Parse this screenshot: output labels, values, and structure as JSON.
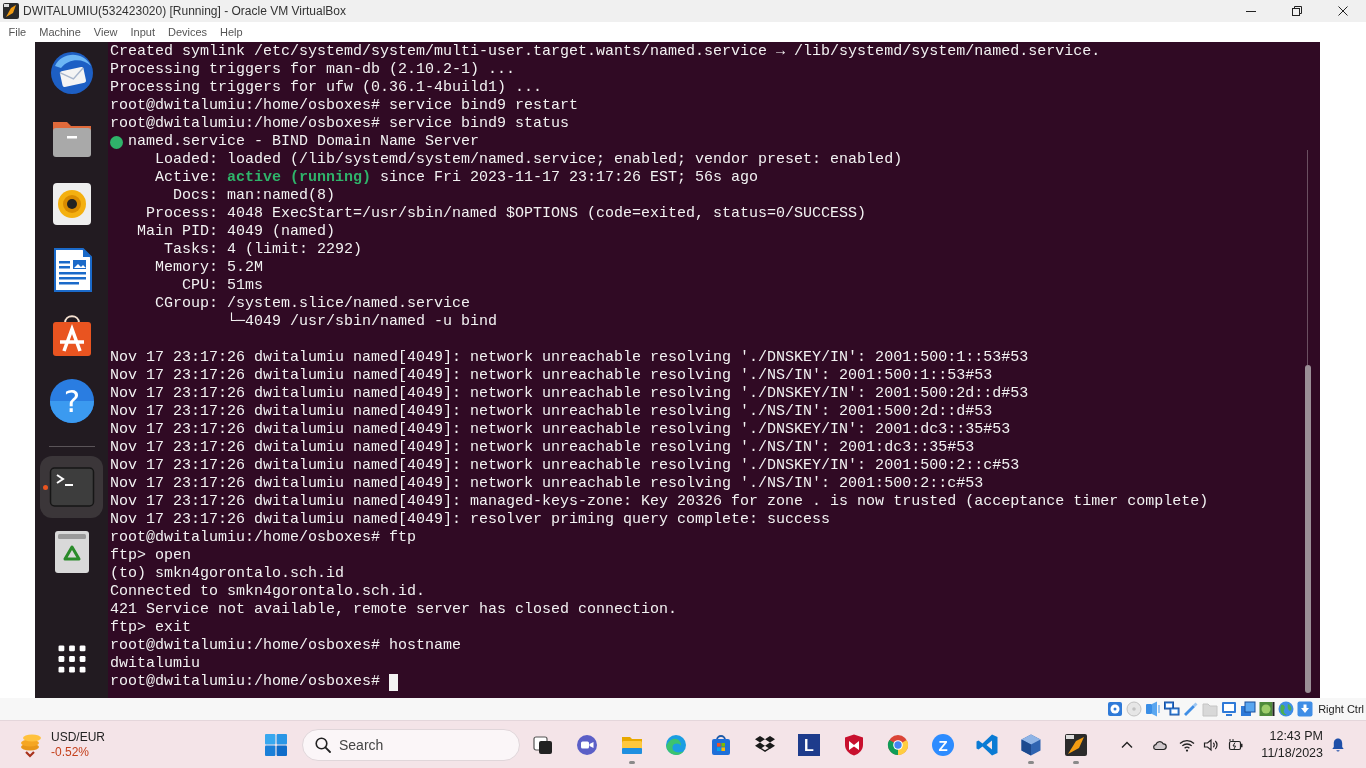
{
  "window": {
    "title": "DWITALUMIU(532423020) [Running] - Oracle VM VirtualBox"
  },
  "menu": [
    "File",
    "Machine",
    "View",
    "Input",
    "Devices",
    "Help"
  ],
  "dock": {
    "groups": [
      {
        "items": [
          {
            "kind": "mail",
            "selected": false,
            "running": false
          },
          {
            "kind": "files",
            "selected": false,
            "running": false
          },
          {
            "kind": "music",
            "selected": false,
            "running": false
          },
          {
            "kind": "writer",
            "selected": false,
            "running": false
          },
          {
            "kind": "store",
            "selected": false,
            "running": false
          },
          {
            "kind": "help",
            "glyph": "?",
            "selected": false,
            "running": false
          }
        ]
      },
      {
        "items": [
          {
            "kind": "terminal",
            "selected": true,
            "running": true
          },
          {
            "kind": "trash",
            "selected": false,
            "running": false
          }
        ]
      }
    ]
  },
  "terminal": {
    "cursor": true,
    "lines": [
      {
        "kind": "text",
        "text": "Created symlink /etc/systemd/system/multi-user.target.wants/named.service → /lib/systemd/system/named.service."
      },
      {
        "kind": "text",
        "text": "Processing triggers for man-db (2.10.2-1) ..."
      },
      {
        "kind": "text",
        "text": "Processing triggers for ufw (0.36.1-4build1) ..."
      },
      {
        "kind": "text",
        "text": "root@dwitalumiu:/home/osboxes# service bind9 restart"
      },
      {
        "kind": "text",
        "text": "root@dwitalumiu:/home/osboxes# service bind9 status"
      },
      {
        "kind": "unit",
        "text": "named.service - BIND Domain Name Server"
      },
      {
        "kind": "text",
        "text": "     Loaded: loaded (/lib/systemd/system/named.service; enabled; vendor preset: enabled)"
      },
      {
        "kind": "text",
        "text": "     Active: **active (running)** since Fri 2023-11-17 23:17:26 EST; 56s ago"
      },
      {
        "kind": "text",
        "text": "       Docs: man:named(8)"
      },
      {
        "kind": "text",
        "text": "    Process: 4048 ExecStart=/usr/sbin/named $OPTIONS (code=exited, status=0/SUCCESS)"
      },
      {
        "kind": "text",
        "text": "   Main PID: 4049 (named)"
      },
      {
        "kind": "text",
        "text": "      Tasks: 4 (limit: 2292)"
      },
      {
        "kind": "text",
        "text": "     Memory: 5.2M"
      },
      {
        "kind": "text",
        "text": "        CPU: 51ms"
      },
      {
        "kind": "text",
        "text": "     CGroup: /system.slice/named.service"
      },
      {
        "kind": "text",
        "text": "             └─4049 /usr/sbin/named -u bind"
      },
      {
        "kind": "blank"
      },
      {
        "kind": "text",
        "text": "Nov 17 23:17:26 dwitalumiu named[4049]: network unreachable resolving './DNSKEY/IN': 2001:500:1::53#53"
      },
      {
        "kind": "text",
        "text": "Nov 17 23:17:26 dwitalumiu named[4049]: network unreachable resolving './NS/IN': 2001:500:1::53#53"
      },
      {
        "kind": "text",
        "text": "Nov 17 23:17:26 dwitalumiu named[4049]: network unreachable resolving './DNSKEY/IN': 2001:500:2d::d#53"
      },
      {
        "kind": "text",
        "text": "Nov 17 23:17:26 dwitalumiu named[4049]: network unreachable resolving './NS/IN': 2001:500:2d::d#53"
      },
      {
        "kind": "text",
        "text": "Nov 17 23:17:26 dwitalumiu named[4049]: network unreachable resolving './DNSKEY/IN': 2001:dc3::35#53"
      },
      {
        "kind": "text",
        "text": "Nov 17 23:17:26 dwitalumiu named[4049]: network unreachable resolving './NS/IN': 2001:dc3::35#53"
      },
      {
        "kind": "text",
        "text": "Nov 17 23:17:26 dwitalumiu named[4049]: network unreachable resolving './DNSKEY/IN': 2001:500:2::c#53"
      },
      {
        "kind": "text",
        "text": "Nov 17 23:17:26 dwitalumiu named[4049]: network unreachable resolving './NS/IN': 2001:500:2::c#53"
      },
      {
        "kind": "text",
        "text": "Nov 17 23:17:26 dwitalumiu named[4049]: managed-keys-zone: Key 20326 for zone . is now trusted (acceptance timer complete)"
      },
      {
        "kind": "text",
        "text": "Nov 17 23:17:26 dwitalumiu named[4049]: resolver priming query complete: success"
      },
      {
        "kind": "text",
        "text": "root@dwitalumiu:/home/osboxes# ftp"
      },
      {
        "kind": "text",
        "text": "ftp> open"
      },
      {
        "kind": "text",
        "text": "(to) smkn4gorontalo.sch.id"
      },
      {
        "kind": "text",
        "text": "Connected to smkn4gorontalo.sch.id."
      },
      {
        "kind": "text",
        "text": "421 Service not available, remote server has closed connection."
      },
      {
        "kind": "text",
        "text": "ftp> exit"
      },
      {
        "kind": "text",
        "text": "root@dwitalumiu:/home/osboxes# hostname"
      },
      {
        "kind": "text",
        "text": "dwitalumiu"
      },
      {
        "kind": "prompt",
        "text": "root@dwitalumiu:/home/osboxes#"
      }
    ]
  },
  "status_bar": {
    "host_key": "Right Ctrl"
  },
  "taskbar": {
    "widget": {
      "title": "USD/EUR",
      "change": "-0.52%"
    },
    "search": {
      "placeholder": "Search"
    },
    "apps": [
      {
        "kind": "task-view",
        "running": false
      },
      {
        "kind": "meet",
        "running": false
      },
      {
        "kind": "explorer",
        "running": true
      },
      {
        "kind": "edge",
        "running": false
      },
      {
        "kind": "store",
        "running": false
      },
      {
        "kind": "dropbox",
        "running": false
      },
      {
        "kind": "letter-tile",
        "glyph": "L",
        "running": false
      },
      {
        "kind": "shield",
        "running": false
      },
      {
        "kind": "chrome",
        "running": false
      },
      {
        "kind": "letter-circle",
        "glyph": "Z",
        "running": false
      },
      {
        "kind": "code",
        "running": false
      },
      {
        "kind": "cube",
        "running": true
      },
      {
        "kind": "vm",
        "running": true
      }
    ],
    "clock": {
      "time": "12:43 PM",
      "date": "11/18/2023"
    }
  }
}
